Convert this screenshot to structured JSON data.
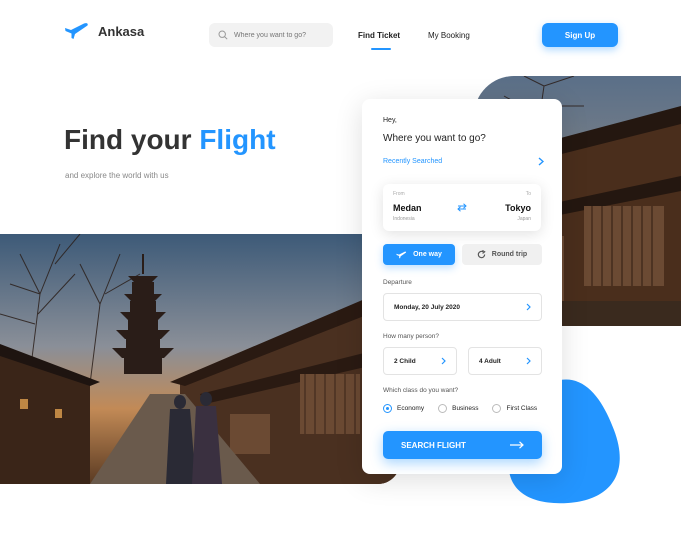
{
  "brand": {
    "name": "Ankasa",
    "accent": "#2395ff"
  },
  "header": {
    "search_placeholder": "Where you want to go?",
    "nav": {
      "find_ticket": "Find Ticket",
      "my_booking": "My Booking"
    },
    "signup_label": "Sign Up"
  },
  "hero": {
    "title_main": "Find your",
    "title_accent": "Flight",
    "subtitle": "and explore the world with us"
  },
  "card": {
    "greeting": "Hey,",
    "question": "Where you want to go?",
    "recent_label": "Recently Searched",
    "route": {
      "from_label": "From",
      "to_label": "To",
      "from_city": "Medan",
      "from_country": "Indonesia",
      "to_city": "Tokyo",
      "to_country": "Japan"
    },
    "trip_type": {
      "one_way": "One way",
      "round_trip": "Round trip",
      "selected": "One way"
    },
    "departure_label": "Departure",
    "departure_value": "Monday, 20 July 2020",
    "persons_label": "How many person?",
    "child_value": "2 Child",
    "adult_value": "4 Adult",
    "class_label": "Which class do you want?",
    "classes": [
      "Economy",
      "Business",
      "First Class"
    ],
    "selected_class": "Economy",
    "search_label": "SEARCH FLIGHT"
  }
}
